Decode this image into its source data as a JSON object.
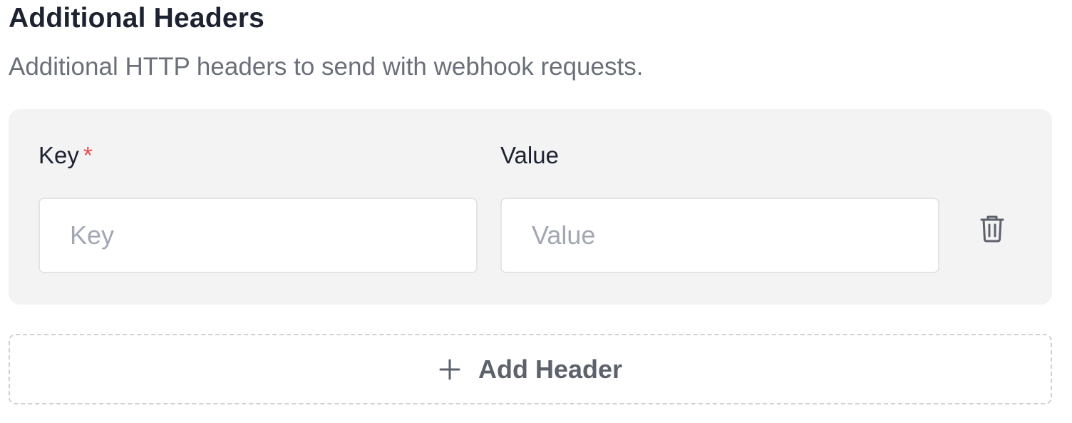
{
  "section": {
    "title": "Additional Headers",
    "description": "Additional HTTP headers to send with webhook requests."
  },
  "header_row": {
    "key_label": "Key",
    "key_required_marker": "*",
    "value_label": "Value",
    "key_input": {
      "value": "",
      "placeholder": "Key"
    },
    "value_input": {
      "value": "",
      "placeholder": "Value"
    },
    "delete_icon": "trash-icon"
  },
  "add_button": {
    "icon": "plus-icon",
    "label": "Add Header"
  },
  "colors": {
    "title": "#1d2230",
    "description": "#6b6f7a",
    "card_background": "#f3f3f4",
    "required": "#e5484d",
    "placeholder": "#a3a7b3",
    "dashed_border": "#cfd1d6",
    "add_label": "#5d616c"
  }
}
